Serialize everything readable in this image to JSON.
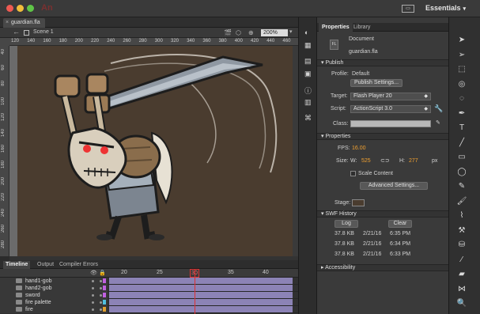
{
  "app": {
    "logo_text": "An",
    "workspace_label": "Essentials",
    "workspace_icon": "workspace-switch-icon"
  },
  "document": {
    "tab_name": "guardian.fla",
    "scene_label": "Scene 1",
    "zoom_value": "200%"
  },
  "ruler": {
    "horizontal_ticks": [
      "120",
      "140",
      "160",
      "180",
      "200",
      "220",
      "240",
      "260",
      "280",
      "300",
      "320",
      "340",
      "360",
      "380",
      "400",
      "420",
      "440",
      "460"
    ],
    "vertical_ticks": [
      "40",
      "60",
      "80",
      "100",
      "120",
      "140",
      "160",
      "180",
      "200",
      "220",
      "240",
      "260",
      "280"
    ]
  },
  "timeline": {
    "tabs": [
      "Timeline",
      "Output",
      "Compiler Errors"
    ],
    "frame_labels": [
      "20",
      "25",
      "30",
      "35",
      "40"
    ],
    "current_frame": "30",
    "layers": [
      {
        "name": "hand1-gob",
        "color": "#c060e0"
      },
      {
        "name": "hand2-gob",
        "color": "#c060e0"
      },
      {
        "name": "sword",
        "color": "#c060e0"
      },
      {
        "name": "fire palette",
        "color": "#50c0e0"
      },
      {
        "name": "fire",
        "color": "#e0a030"
      }
    ]
  },
  "properties": {
    "tabs": [
      "Properties",
      "Library"
    ],
    "header_type": "Document",
    "file_name": "guardian.fla",
    "publish": {
      "section_label": "Publish",
      "profile_label": "Profile:",
      "profile_value": "Default",
      "publish_settings_button": "Publish Settings...",
      "target_label": "Target:",
      "target_value": "Flash Player 20",
      "script_label": "Script:",
      "script_value": "ActionScript 3.0",
      "class_label": "Class:"
    },
    "props": {
      "section_label": "Properties",
      "fps_label": "FPS:",
      "fps_value": "16.00",
      "size_label": "Size:",
      "w_label": "W:",
      "w_value": "525",
      "h_label": "H:",
      "h_value": "277",
      "unit": "px",
      "scale_content_label": "Scale Content",
      "advanced_settings_button": "Advanced Settings...",
      "stage_label": "Stage:",
      "stage_color": "#4a3c2f"
    },
    "swf_history": {
      "section_label": "SWF History",
      "log_button": "Log",
      "clear_button": "Clear",
      "entries": [
        {
          "size": "37.8 KB",
          "date": "2/21/16",
          "time": "6:35 PM"
        },
        {
          "size": "37.8 KB",
          "date": "2/21/16",
          "time": "6:34 PM"
        },
        {
          "size": "37.8 KB",
          "date": "2/21/16",
          "time": "6:33 PM"
        }
      ]
    },
    "accessibility": {
      "section_label": "Accessibility"
    }
  },
  "colors": {
    "stage_bg": "#4a3c2f",
    "frame_span": "#8c83b6",
    "playhead": "#e03030",
    "accent_value": "#f0a030"
  }
}
